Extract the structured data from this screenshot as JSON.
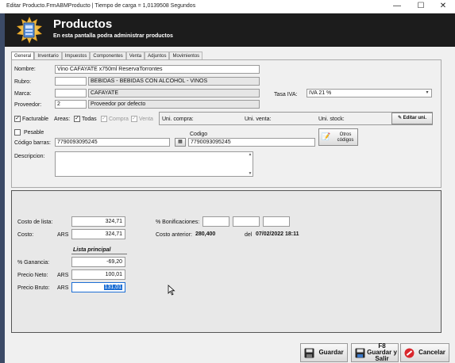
{
  "window": {
    "title": "Editar Producto.FrmABMProducto | Tiempo de carga = 1,0139508 Segundos",
    "minimize": "—",
    "maximize": "☐",
    "close": "✕"
  },
  "header": {
    "title": "Productos",
    "subtitle": "En esta pantalla podra administrar productos"
  },
  "tabs": [
    "General",
    "Inventario",
    "Impuestos",
    "Componentes",
    "Venta",
    "Adjuntos",
    "Movimientos"
  ],
  "form": {
    "nombre_label": "Nombre:",
    "nombre_value": "Vino CAFAYATE x750ml ReservaTorrontes",
    "rubro_label": "Rubro:",
    "rubro_value": "BEBIDAS - BEBIDAS CON ALCOHOL - VINOS",
    "marca_label": "Marca:",
    "marca_value": "CAFAYATE",
    "proveedor_label": "Proveedor:",
    "proveedor_code": "2",
    "proveedor_value": "Proveedor por defecto",
    "tasa_iva_label": "Tasa IVA:",
    "tasa_iva_value": "IVA 21 %",
    "facturable_label": "Facturable",
    "areas_label": "Areas:",
    "todas_label": "Todas",
    "compra_label": "Compra",
    "venta_label": "Venta",
    "uni_compra_label": "Uni. compra:",
    "uni_venta_label": "Uni. venta:",
    "uni_stock_label": "Uni. stock:",
    "editar_uni_label": "Editar uni.",
    "pesable_label": "Pesable",
    "codigo_barras_label": "Código barras:",
    "codigo_barras_value": "7790093095245",
    "codigo_label": "Codigo",
    "codigo_value": "7790093095245",
    "otros_codigos_label": "Otros códigos",
    "descripcion_label": "Descripcion:",
    "descripcion_value": ""
  },
  "pricing": {
    "costo_lista_label": "Costo de lista:",
    "costo_lista_value": "324,71",
    "costo_label": "Costo:",
    "costo_currency": "ARS",
    "costo_value": "324,71",
    "bonificaciones_label": "% Bonificaciones:",
    "costo_anterior_label": "Costo anterior:",
    "costo_anterior_value": "280,400",
    "del_label": "del",
    "del_value": "07/02/2022 18:11",
    "lista_principal_label": "Lista principal",
    "ganancia_label": "% Ganancia:",
    "ganancia_value": "-69,20",
    "precio_neto_label": "Precio Neto:",
    "precio_neto_currency": "ARS",
    "precio_neto_value": "100,01",
    "precio_bruto_label": "Precio Bruto:",
    "precio_bruto_currency": "ARS",
    "precio_bruto_value": "131,01"
  },
  "footer": {
    "guardar_label": "Guardar",
    "guardar_salir_label": "F8 Guardar y Salir",
    "cancelar_label": "Cancelar"
  },
  "colors": {
    "header_bg": "#1c1c1c",
    "selection": "#1e6fd4",
    "cancel_icon": "#d9262c"
  }
}
